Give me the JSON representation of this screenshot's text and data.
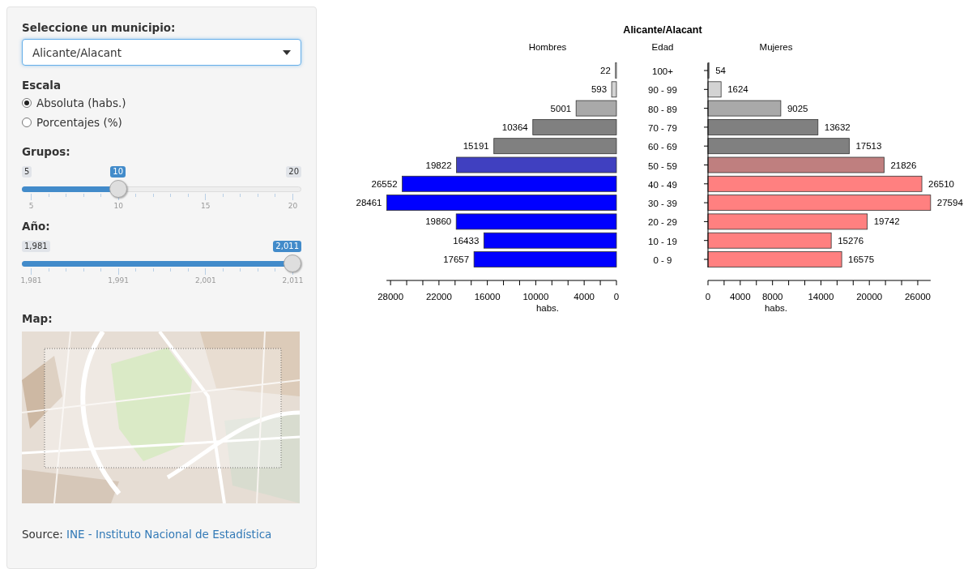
{
  "sidebar": {
    "municipio": {
      "label": "Seleccione un municipio:",
      "value": "Alicante/Alacant"
    },
    "escala": {
      "label": "Escala",
      "options": [
        {
          "label": "Absoluta (habs.)",
          "selected": true
        },
        {
          "label": "Porcentajes (%)",
          "selected": false
        }
      ]
    },
    "sliders": [
      {
        "label": "Grupos:",
        "min_label": "5",
        "max_label": "20",
        "value": "10",
        "level": 0.3333,
        "ticks": [
          "5",
          "10",
          "15",
          "20"
        ]
      },
      {
        "label": "Año:",
        "min_label": "1,981",
        "value": "2,011",
        "level": 1,
        "ticks": [
          "1,981",
          "1,991",
          "2,001",
          "2,011"
        ]
      }
    ],
    "map": {
      "label": "Map:",
      "kind": "picture"
    },
    "source": {
      "label": "Source:",
      "link": "INE - Instituto Nacional de Estadística"
    }
  },
  "plot": {
    "title": "Alicante/Alacant",
    "age_heading": "Edad",
    "charts": [
      {
        "chart_data": {
          "type": "bar",
          "orientation": "horizontal",
          "xlabel": "habs.",
          "xlim": [
            28500,
            0
          ],
          "xticks": [
            28000,
            22000,
            16000,
            10000,
            4000,
            0
          ],
          "data_labels": true,
          "categories": [
            "100+",
            "90 - 99",
            "80 - 89",
            "70 - 79",
            "60 - 69",
            "50 - 59",
            "40 - 49",
            "30 - 39",
            "20 - 29",
            "10 - 19",
            "0 - 9"
          ],
          "series": [
            {
              "name": "Hombres",
              "values": [
                22,
                593,
                5001,
                10364,
                15191,
                19822,
                26552,
                28461,
                19860,
                16433,
                17657
              ],
              "colors": [
                "#d3d3d3",
                "#d3d3d3",
                "#a9a9a9",
                "#808080",
                "#808080",
                "#4040c0",
                "#0000ff",
                "#0000ff",
                "#0000ff",
                "#0000ff",
                "#0000ff"
              ]
            }
          ]
        }
      },
      {
        "chart_data": {
          "type": "bar",
          "orientation": "horizontal",
          "xlabel": "habs.",
          "xlim": [
            0,
            27600
          ],
          "xticks": [
            0,
            4000,
            8000,
            14000,
            20000,
            26000
          ],
          "data_labels": true,
          "categories": [
            null,
            null,
            null,
            null,
            null,
            null,
            null,
            null,
            null,
            null,
            null
          ],
          "series": [
            {
              "name": "Mujeres",
              "values": [
                54,
                1624,
                9025,
                13632,
                17513,
                21826,
                26510,
                27594,
                19742,
                15276,
                16575
              ],
              "colors": [
                "#d3d3d3",
                "#d3d3d3",
                "#a9a9a9",
                "#808080",
                "#808080",
                "#bf7f7f",
                "#ff8080",
                "#ff8080",
                "#ff8080",
                "#ff8080",
                "#ff8080"
              ]
            }
          ]
        }
      }
    ]
  }
}
